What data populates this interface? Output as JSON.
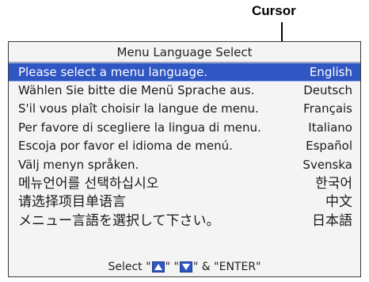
{
  "callout": {
    "label": "Cursor"
  },
  "menu": {
    "title": "Menu Language Select",
    "rows": [
      {
        "prompt": "Please select a menu  language.",
        "language": "English"
      },
      {
        "prompt": "Wählen Sie bitte die Menü Sprache aus.",
        "language": "Deutsch"
      },
      {
        "prompt": "S'il vous plaît choisir la langue de menu.",
        "language": "Français"
      },
      {
        "prompt": "Per favore di scegliere la lingua di menu.",
        "language": "Italiano"
      },
      {
        "prompt": "Escoja por favor el idioma de menú.",
        "language": "Español"
      },
      {
        "prompt": "Välj menyn språken.",
        "language": "Svenska"
      },
      {
        "prompt": "메뉴언어를 선택하십시오",
        "language": "한국어"
      },
      {
        "prompt": "请选择项目单语言",
        "language": "中文"
      },
      {
        "prompt": "メニュー言語を選択して下さい。",
        "language": "日本語"
      }
    ],
    "selected_index": 0,
    "footer": {
      "prefix": "Select \"",
      "middle": "\" \"",
      "suffix": "\" & \"ENTER\"",
      "up_icon": "up-arrow-icon",
      "down_icon": "down-arrow-icon"
    }
  },
  "colors": {
    "selection": "#2f56c2",
    "panel_background": "#f4f4f4"
  }
}
